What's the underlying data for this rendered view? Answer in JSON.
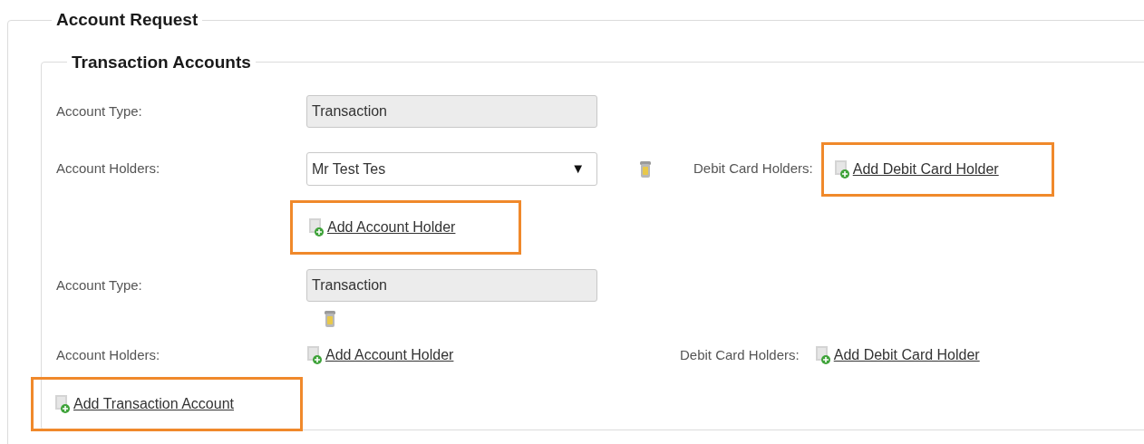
{
  "section": {
    "title": "Account Request"
  },
  "subsection": {
    "title": "Transaction Accounts"
  },
  "accounts": [
    {
      "kind": "with_holder",
      "type_label": "Account Type:",
      "type_value": "Transaction",
      "holders_label": "Account Holders:",
      "holder_value": "Mr Test Tes",
      "dropdown_arrow": "▼",
      "add_holder": {
        "label": "Add Account Holder",
        "highlighted": true
      },
      "debit_label": "Debit Card Holders:",
      "add_debit": {
        "label": "Add Debit Card Holder",
        "highlighted": true
      }
    },
    {
      "kind": "empty",
      "type_label": "Account Type:",
      "type_value": "Transaction",
      "holders_label": "Account Holders:",
      "add_holder": {
        "label": "Add Account Holder",
        "highlighted": false
      },
      "debit_label": "Debit Card Holders:",
      "add_debit": {
        "label": "Add Debit Card Holder",
        "highlighted": false
      }
    }
  ],
  "add_account": {
    "label": "Add Transaction Account",
    "highlighted": true
  }
}
